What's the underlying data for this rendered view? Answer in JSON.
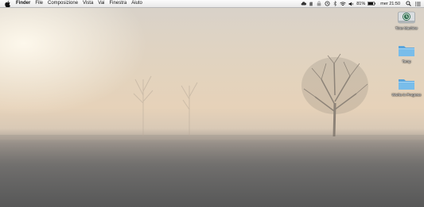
{
  "menubar": {
    "apple_icon": "apple-icon",
    "items": [
      "Finder",
      "File",
      "Composizione",
      "Vista",
      "Vai",
      "Finestra",
      "Aiuto"
    ],
    "status_icons": [
      "cloud-icon",
      "evernote-icon",
      "lock-icon",
      "time-machine-icon",
      "bluetooth-icon",
      "wifi-icon",
      "volume-icon"
    ],
    "battery_text": "81%",
    "clock": "mer 21:50",
    "right_icons": [
      "spotlight-search-icon",
      "notification-center-icon"
    ]
  },
  "desktop_icons": [
    {
      "label": "Time Machine",
      "icon": "time-machine-drive-icon"
    },
    {
      "label": "Temp",
      "icon": "folder-icon"
    },
    {
      "label": "Works in Progress",
      "icon": "folder-icon"
    }
  ],
  "colors": {
    "menubar": "#f2f2f2",
    "folder": "#6fb3e6",
    "sky": "#e4d3bd",
    "field": "#606060"
  }
}
